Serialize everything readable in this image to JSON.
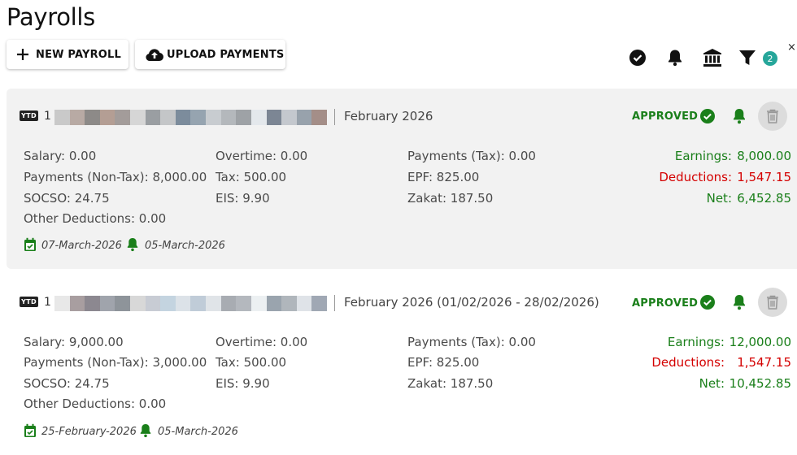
{
  "page": {
    "title": "Payrolls"
  },
  "toolbar": {
    "new_payroll_label": "NEW PAYROLL",
    "upload_payments_label": "UPLOAD PAYMENTS",
    "filter_count": "2",
    "close_label": "×",
    "icons": [
      "check-circle-icon",
      "bell-icon",
      "bank-icon",
      "filter-icon"
    ]
  },
  "colors": {
    "approved": "#1a7f1a",
    "deductions": "#d40000",
    "badge": "#26a69a",
    "card_bg": "#f2f2f2"
  },
  "payrolls": [
    {
      "ytd_label": "YTD",
      "employee_no": "1",
      "period": "February 2026",
      "status": "APPROVED",
      "fields": {
        "salary": "Salary: 0.00",
        "payments_non_tax": "Payments (Non-Tax): 8,000.00",
        "socso": "SOCSO: 24.75",
        "other_deductions": "Other Deductions: 0.00",
        "overtime": "Overtime: 0.00",
        "tax": "Tax: 500.00",
        "eis": "EIS: 9.90",
        "payments_tax": "Payments (Tax): 0.00",
        "epf": "EPF: 825.00",
        "zakat": "Zakat: 187.50"
      },
      "summary": {
        "earnings_label": "Earnings:",
        "earnings": "8,000.00",
        "deductions_label": "Deductions:",
        "deductions": "1,547.15",
        "net_label": "Net:",
        "net": "6,452.85"
      },
      "pay_date": "07-March-2026",
      "reminder_date": "05-March-2026"
    },
    {
      "ytd_label": "YTD",
      "employee_no": "1",
      "period": "February 2026  (01/02/2026 - 28/02/2026)",
      "status": "APPROVED",
      "fields": {
        "salary": "Salary: 9,000.00",
        "payments_non_tax": "Payments (Non-Tax): 3,000.00",
        "socso": "SOCSO: 24.75",
        "other_deductions": "Other Deductions: 0.00",
        "overtime": "Overtime: 0.00",
        "tax": "Tax: 500.00",
        "eis": "EIS: 9.90",
        "payments_tax": "Payments (Tax): 0.00",
        "epf": "EPF: 825.00",
        "zakat": "Zakat: 187.50"
      },
      "summary": {
        "earnings_label": "Earnings:",
        "earnings": "12,000.00",
        "deductions_label": "Deductions:",
        "deductions": "1,547.15",
        "net_label": "Net:",
        "net": "10,452.85"
      },
      "pay_date": "25-February-2026",
      "reminder_date": "05-March-2026"
    }
  ]
}
